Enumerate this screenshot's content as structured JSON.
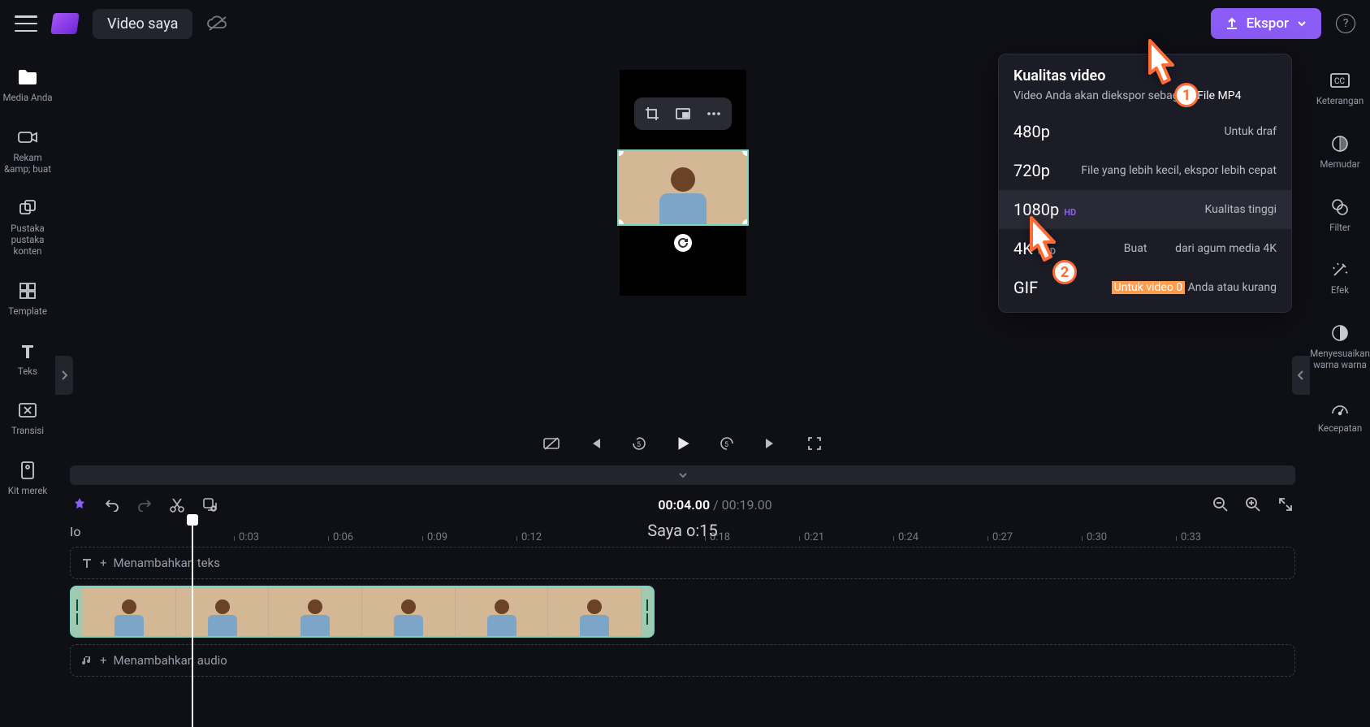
{
  "header": {
    "title": "Video saya",
    "export_label": "Ekspor"
  },
  "left_nav": {
    "media": "Media Anda",
    "record": "Rekam &amp; buat",
    "library": "Pustaka pustaka konten",
    "template": "Template",
    "text": "Teks",
    "transition": "Transisi",
    "brand": "Kit merek"
  },
  "right_nav": {
    "caption": "Keterangan",
    "fade": "Memudar",
    "filter": "Filter",
    "effect": "Efek",
    "color": "Menyesuaikan warna warna",
    "speed": "Kecepatan"
  },
  "playback": {
    "current": "00:04.00",
    "duration": "00:19.00"
  },
  "ruler": {
    "t0": "Io",
    "center": "Saya o:15",
    "ticks": [
      "0:03",
      "0:06",
      "0:09",
      "0:12",
      "0:18",
      "0:21",
      "0:24",
      "0:27",
      "0:30",
      "0:33"
    ]
  },
  "tracks": {
    "add_text": "Menambahkan teks",
    "add_audio": "Menambahkan audio"
  },
  "export_panel": {
    "title": "Kualitas video",
    "subtitle": "Video Anda akan diekspor sebagai",
    "file_type": "File MP4",
    "options": [
      {
        "q": "480p",
        "desc": "Untuk draf"
      },
      {
        "q": "720p",
        "desc": "File yang lebih kecil, ekspor lebih cepat"
      },
      {
        "q": "1080p",
        "badge": "HD",
        "desc": "Kualitas tinggi"
      },
      {
        "q": "4K",
        "badge": "UHD",
        "desc_pre": "Buat",
        "desc_post": "dari agum media 4K"
      },
      {
        "q": "GIF",
        "desc_hl": "Untuk video 0",
        "desc_post": " Anda atau kurang"
      }
    ]
  },
  "annotations": {
    "p1": "1",
    "p2": "2"
  }
}
